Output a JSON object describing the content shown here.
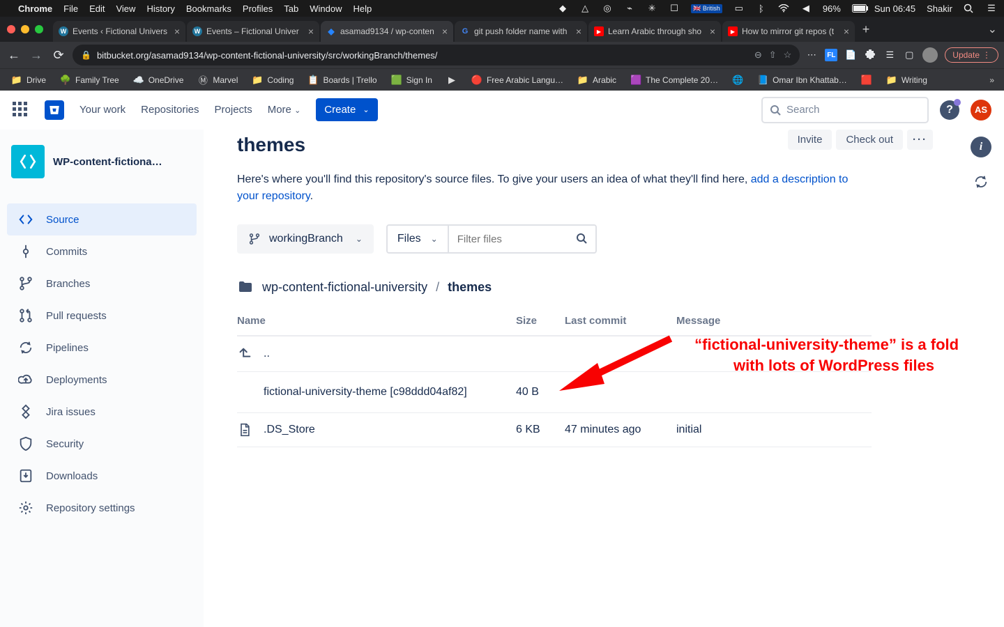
{
  "mac_menu": {
    "app": "Chrome",
    "items": [
      "File",
      "Edit",
      "View",
      "History",
      "Bookmarks",
      "Profiles",
      "Tab",
      "Window",
      "Help"
    ],
    "locale": "British",
    "battery": "96%",
    "clock": "Sun 06:45",
    "user": "Shakir"
  },
  "chrome": {
    "tabs": [
      {
        "title": "Events ‹ Fictional Univers",
        "fav": "wp"
      },
      {
        "title": "Events – Fictional Univer",
        "fav": "wp"
      },
      {
        "title": "asamad9134 / wp-conten",
        "fav": "bb",
        "active": true
      },
      {
        "title": "git push folder name with",
        "fav": "g"
      },
      {
        "title": "Learn Arabic through sho",
        "fav": "yt"
      },
      {
        "title": "How to mirror git repos (t",
        "fav": "yt"
      }
    ],
    "url": "bitbucket.org/asamad9134/wp-content-fictional-university/src/workingBranch/themes/",
    "update_label": "Update"
  },
  "bookmarks": [
    {
      "label": "Drive",
      "icon": "📁"
    },
    {
      "label": "Family Tree",
      "icon": "🌳"
    },
    {
      "label": "OneDrive",
      "icon": "☁️"
    },
    {
      "label": "Marvel",
      "icon": "Ⓜ"
    },
    {
      "label": "Coding",
      "icon": "📁"
    },
    {
      "label": "Boards | Trello",
      "icon": "📋"
    },
    {
      "label": "Sign In",
      "icon": "🟩"
    },
    {
      "label": "",
      "icon": "▶"
    },
    {
      "label": "Free Arabic Langu…",
      "icon": "🔴"
    },
    {
      "label": "Arabic",
      "icon": "📁"
    },
    {
      "label": "The Complete 20…",
      "icon": "🟪"
    },
    {
      "label": "",
      "icon": "🌐"
    },
    {
      "label": "Omar Ibn Khattab…",
      "icon": "📘"
    },
    {
      "label": "",
      "icon": "🟥"
    },
    {
      "label": "Writing",
      "icon": "📁"
    }
  ],
  "bb_nav": {
    "links": [
      "Your work",
      "Repositories",
      "Projects"
    ],
    "more": "More",
    "create": "Create",
    "search_placeholder": "Search",
    "avatar_initials": "AS"
  },
  "sidebar": {
    "repo_name": "WP-content-fictiona…",
    "items": [
      {
        "label": "Source",
        "active": true
      },
      {
        "label": "Commits"
      },
      {
        "label": "Branches"
      },
      {
        "label": "Pull requests"
      },
      {
        "label": "Pipelines"
      },
      {
        "label": "Deployments"
      },
      {
        "label": "Jira issues"
      },
      {
        "label": "Security"
      },
      {
        "label": "Downloads"
      },
      {
        "label": "Repository settings"
      }
    ]
  },
  "main": {
    "title": "themes",
    "actions": {
      "invite": "Invite",
      "checkout": "Check out",
      "more": "···"
    },
    "desc_pre": "Here's where you'll find this repository's source files. To give your users an idea of what they'll find here, ",
    "desc_link": "add a description to your repository",
    "branch": "workingBranch",
    "files_label": "Files",
    "filter_placeholder": "Filter files",
    "breadcrumb": {
      "root": "wp-content-fictional-university",
      "current": "themes"
    },
    "columns": {
      "name": "Name",
      "size": "Size",
      "commit": "Last commit",
      "msg": "Message"
    },
    "rows": [
      {
        "type": "up",
        "name": ".."
      },
      {
        "type": "submodule",
        "name": "fictional-university-theme [c98ddd04af82]",
        "size": "40 B",
        "commit": "",
        "msg": ""
      },
      {
        "type": "file",
        "name": ".DS_Store",
        "size": "6 KB",
        "commit": "47 minutes ago",
        "msg": "initial"
      }
    ]
  },
  "annotation": {
    "line1": "“fictional-university-theme” is a folder",
    "line2": "with lots of WordPress files"
  }
}
